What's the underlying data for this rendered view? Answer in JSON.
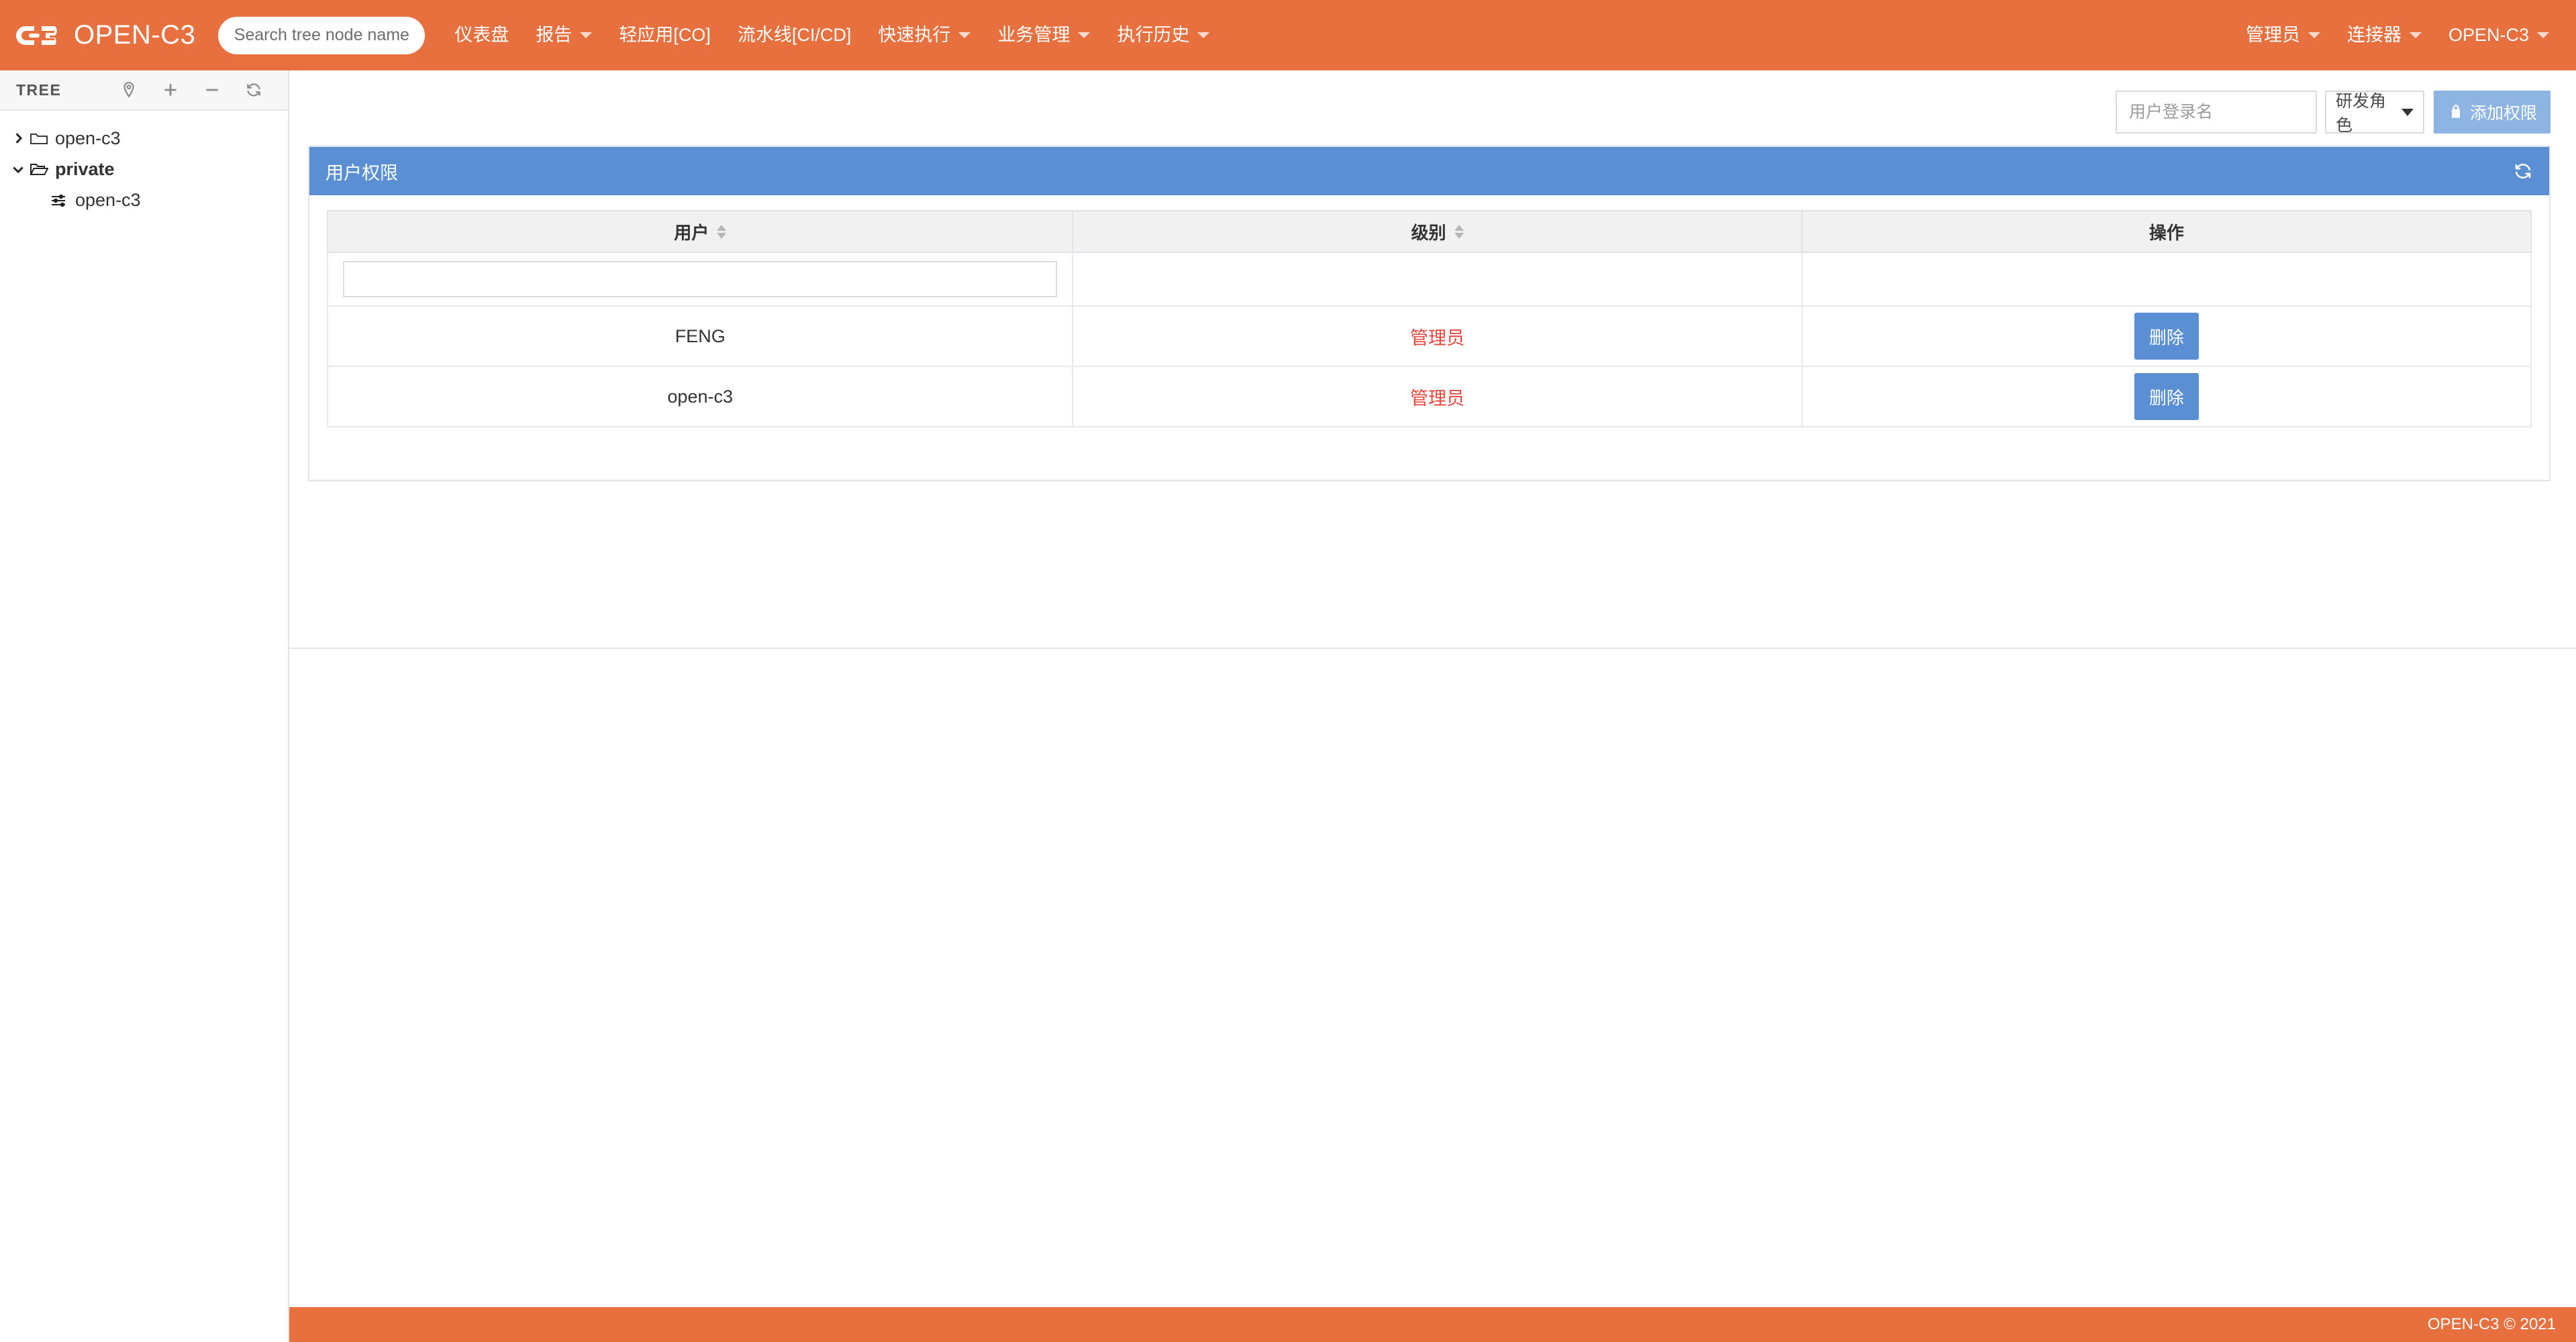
{
  "colors": {
    "brand_orange": "#e8703f",
    "panel_blue": "#5b8fd4",
    "button_light_blue": "#8eb4e3",
    "danger_red": "#e8453c"
  },
  "navbar": {
    "brand": "OPEN-C3",
    "logo_icon": "c3-logo-icon",
    "search": {
      "placeholder": "Search tree node name",
      "value": ""
    },
    "items": [
      {
        "label": "仪表盘",
        "has_caret": false
      },
      {
        "label": "报告",
        "has_caret": true
      },
      {
        "label": "轻应用[CO]",
        "has_caret": false
      },
      {
        "label": "流水线[CI/CD]",
        "has_caret": false
      },
      {
        "label": "快速执行",
        "has_caret": true
      },
      {
        "label": "业务管理",
        "has_caret": true
      },
      {
        "label": "执行历史",
        "has_caret": true
      }
    ],
    "right_items": [
      {
        "label": "管理员",
        "has_caret": true
      },
      {
        "label": "连接器",
        "has_caret": true
      },
      {
        "label": "OPEN-C3",
        "has_caret": true
      }
    ]
  },
  "sidebar": {
    "title": "TREE",
    "tools": [
      {
        "icon": "location-pin-icon"
      },
      {
        "icon": "plus-icon"
      },
      {
        "icon": "minus-icon"
      },
      {
        "icon": "refresh-icon"
      }
    ],
    "tree": [
      {
        "label": "open-c3",
        "level": 1,
        "expanded": false,
        "icon": "folder-closed-icon",
        "twisty": "chevron-right-icon",
        "bold": false
      },
      {
        "label": "private",
        "level": 1,
        "expanded": true,
        "icon": "folder-open-icon",
        "twisty": "chevron-down-icon",
        "bold": true
      },
      {
        "label": "open-c3",
        "level": 2,
        "expanded": null,
        "icon": "sliders-icon",
        "twisty": "",
        "bold": false
      }
    ]
  },
  "toolbar": {
    "user_input": {
      "placeholder": "用户登录名",
      "value": ""
    },
    "role_select": {
      "value": "研发角色",
      "options": [
        "研发角色"
      ],
      "icon": "chevron-down-icon"
    },
    "add_button": {
      "label": "添加权限",
      "icon": "user-lock-icon"
    }
  },
  "panel": {
    "title": "用户权限",
    "refresh_icon": "refresh-icon"
  },
  "table": {
    "columns": [
      {
        "label": "用户",
        "sortable": true
      },
      {
        "label": "级别",
        "sortable": true
      },
      {
        "label": "操作",
        "sortable": false
      }
    ],
    "filter_row": {
      "user_filter": {
        "value": "",
        "placeholder": ""
      }
    },
    "rows": [
      {
        "user": "FENG",
        "level": "管理员",
        "action": "删除"
      },
      {
        "user": "open-c3",
        "level": "管理员",
        "action": "删除"
      }
    ]
  },
  "footer": {
    "text": "OPEN-C3 © 2021"
  }
}
